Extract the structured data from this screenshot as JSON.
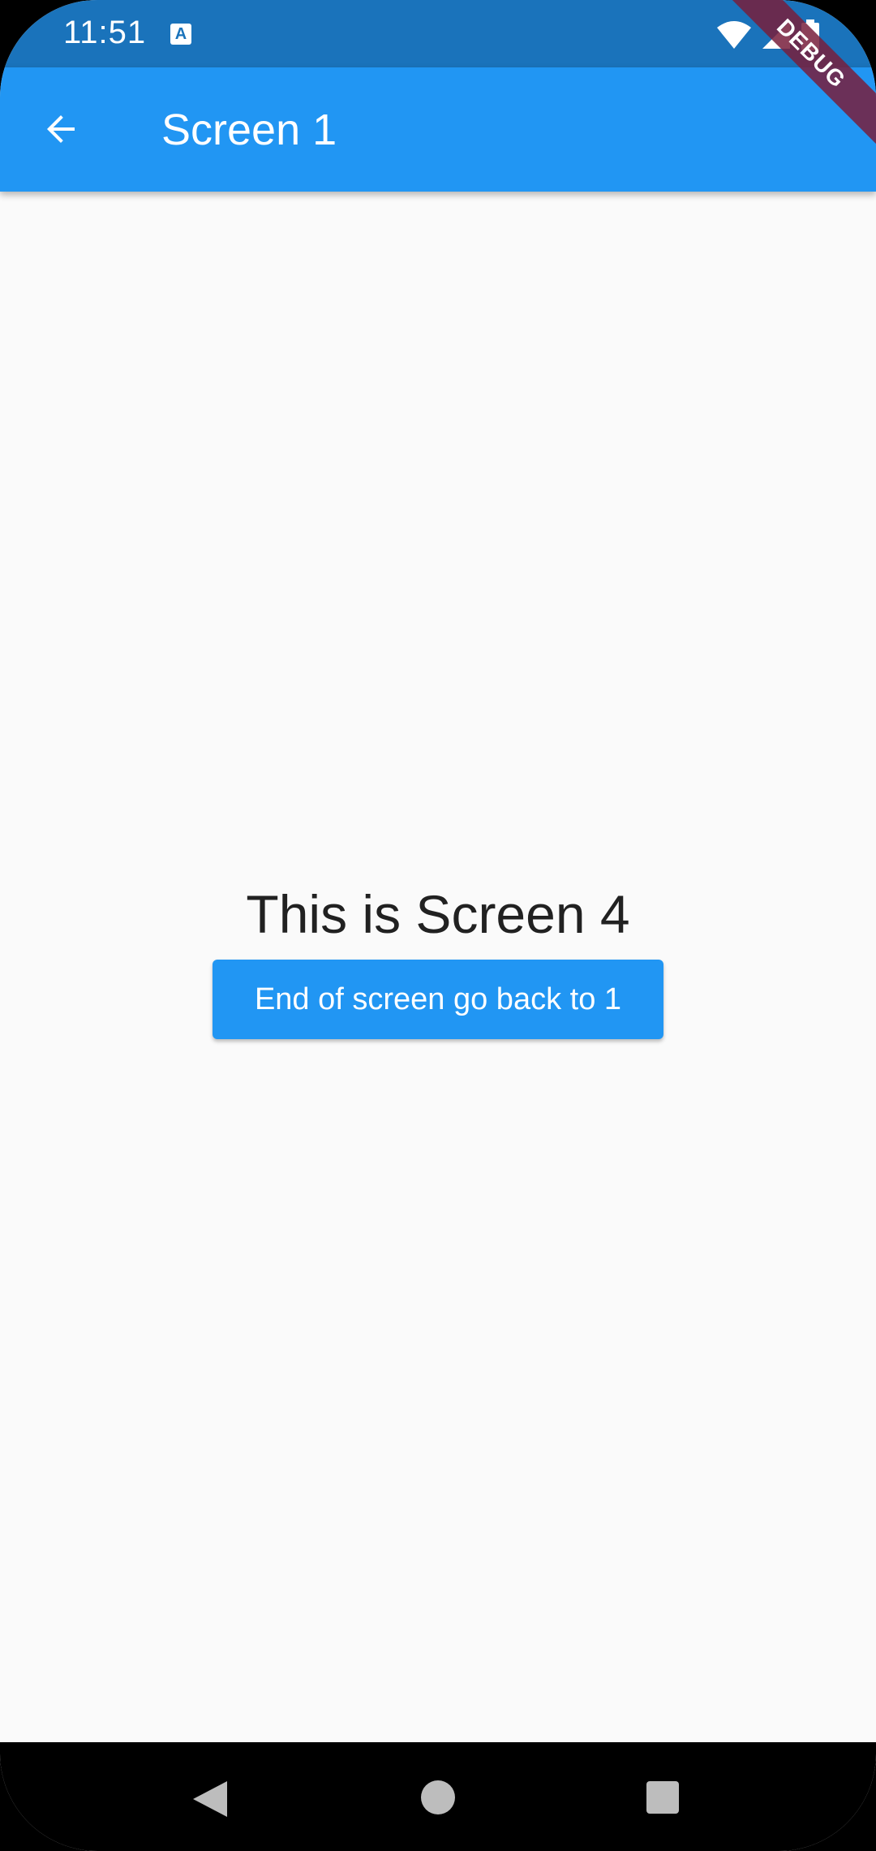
{
  "status_bar": {
    "time": "11:51",
    "notification_letter": "A",
    "icons": [
      "wifi-icon",
      "cell-signal-icon",
      "battery-icon"
    ]
  },
  "app_bar": {
    "title": "Screen 1",
    "back_icon": "arrow-left-icon",
    "background_color": "#2196f3"
  },
  "debug_banner": {
    "label": "DEBUG"
  },
  "main": {
    "heading": "This is Screen 4",
    "button_label": "End of screen go back to 1"
  },
  "nav_bar": {
    "items": [
      "back-triangle-icon",
      "home-circle-icon",
      "recents-square-icon"
    ]
  },
  "colors": {
    "status_bar": "#1a73bb",
    "primary": "#2196f3",
    "background": "#fafafa",
    "text": "#212121"
  }
}
